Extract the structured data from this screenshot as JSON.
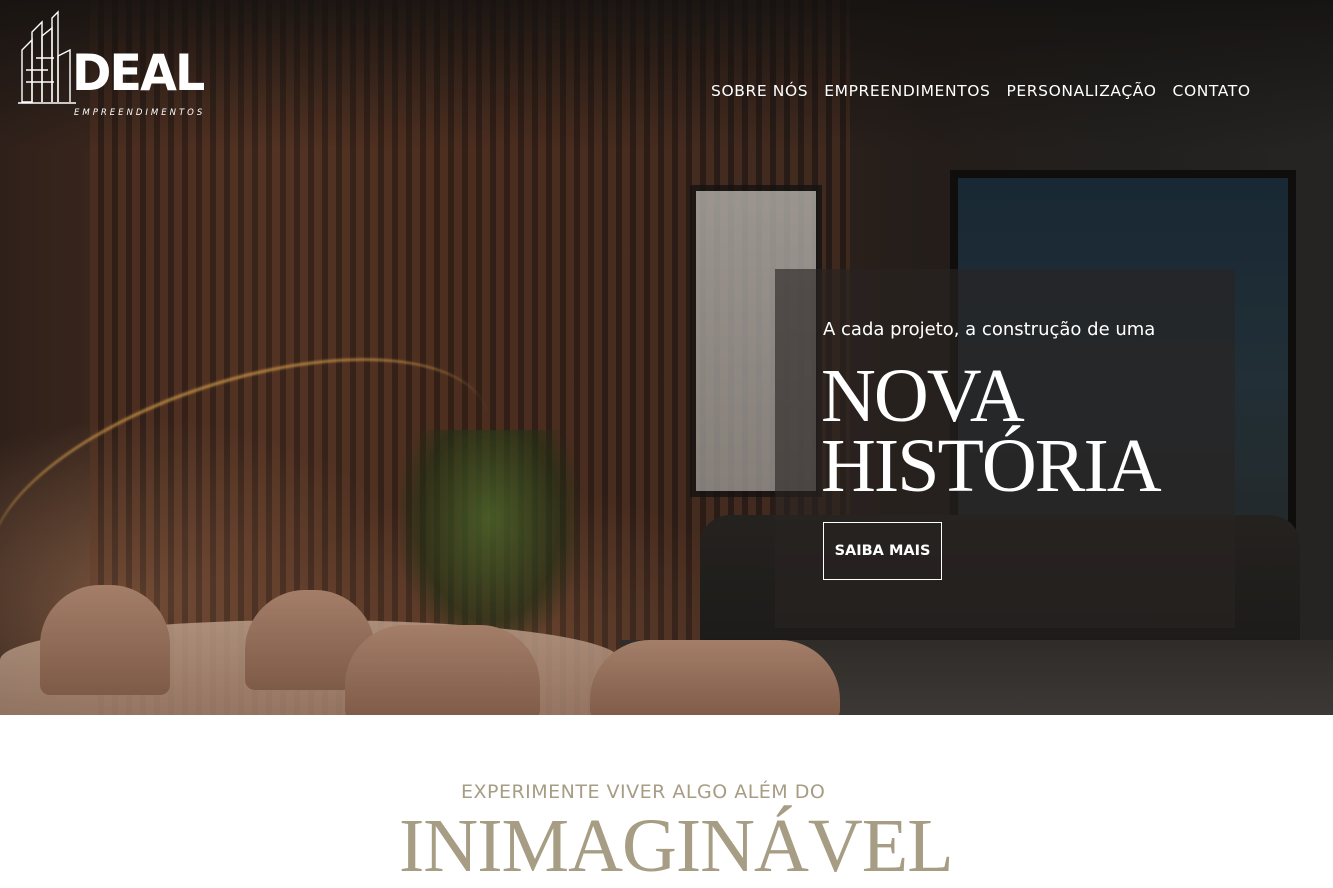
{
  "brand": {
    "name": "DEAL",
    "tagline": "EMPREENDIMENTOS"
  },
  "nav": {
    "items": [
      {
        "label": "SOBRE NÓS"
      },
      {
        "label": "EMPREENDIMENTOS"
      },
      {
        "label": "PERSONALIZAÇÃO"
      },
      {
        "label": "CONTATO"
      }
    ]
  },
  "hero": {
    "kicker": "A cada projeto, a construção de uma",
    "headline_line1": "NOVA",
    "headline_line2": "HISTÓRIA",
    "cta_label": "SAIBA MAIS"
  },
  "intro": {
    "subtitle": "EXPERIMENTE VIVER ALGO ALÉM DO",
    "title": "INIMAGINÁVEL"
  },
  "colors": {
    "accent": "#a79c84",
    "white": "#ffffff"
  },
  "icons": {
    "logo": "building-outline-logo"
  }
}
